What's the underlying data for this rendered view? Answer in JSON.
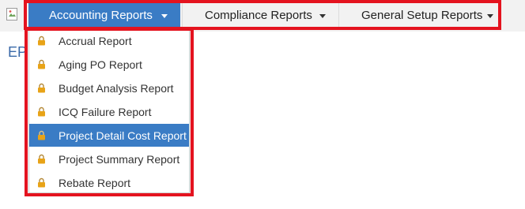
{
  "menubar": {
    "menus": [
      {
        "label": "Accounting Reports"
      },
      {
        "label": "Compliance Reports"
      },
      {
        "label": "General Setup Reports"
      }
    ]
  },
  "dropdown": {
    "items": [
      {
        "label": "Accrual Report",
        "icon": "lock-icon"
      },
      {
        "label": "Aging PO Report",
        "icon": "lock-icon"
      },
      {
        "label": "Budget Analysis Report",
        "icon": "lock-icon"
      },
      {
        "label": "ICQ Failure Report",
        "icon": "lock-icon"
      },
      {
        "label": "Project Detail Cost Report",
        "icon": "lock-icon",
        "selected": true
      },
      {
        "label": "Project Summary Report",
        "icon": "lock-icon"
      },
      {
        "label": "Rebate Report",
        "icon": "lock-icon"
      }
    ]
  },
  "page": {
    "heading_fragment": "EP"
  },
  "colors": {
    "menu_active": "#3a7cc5",
    "highlight_red": "#e4131f",
    "menubar_bg": "#f2f2f2",
    "lock_gold": "#e8a317"
  }
}
